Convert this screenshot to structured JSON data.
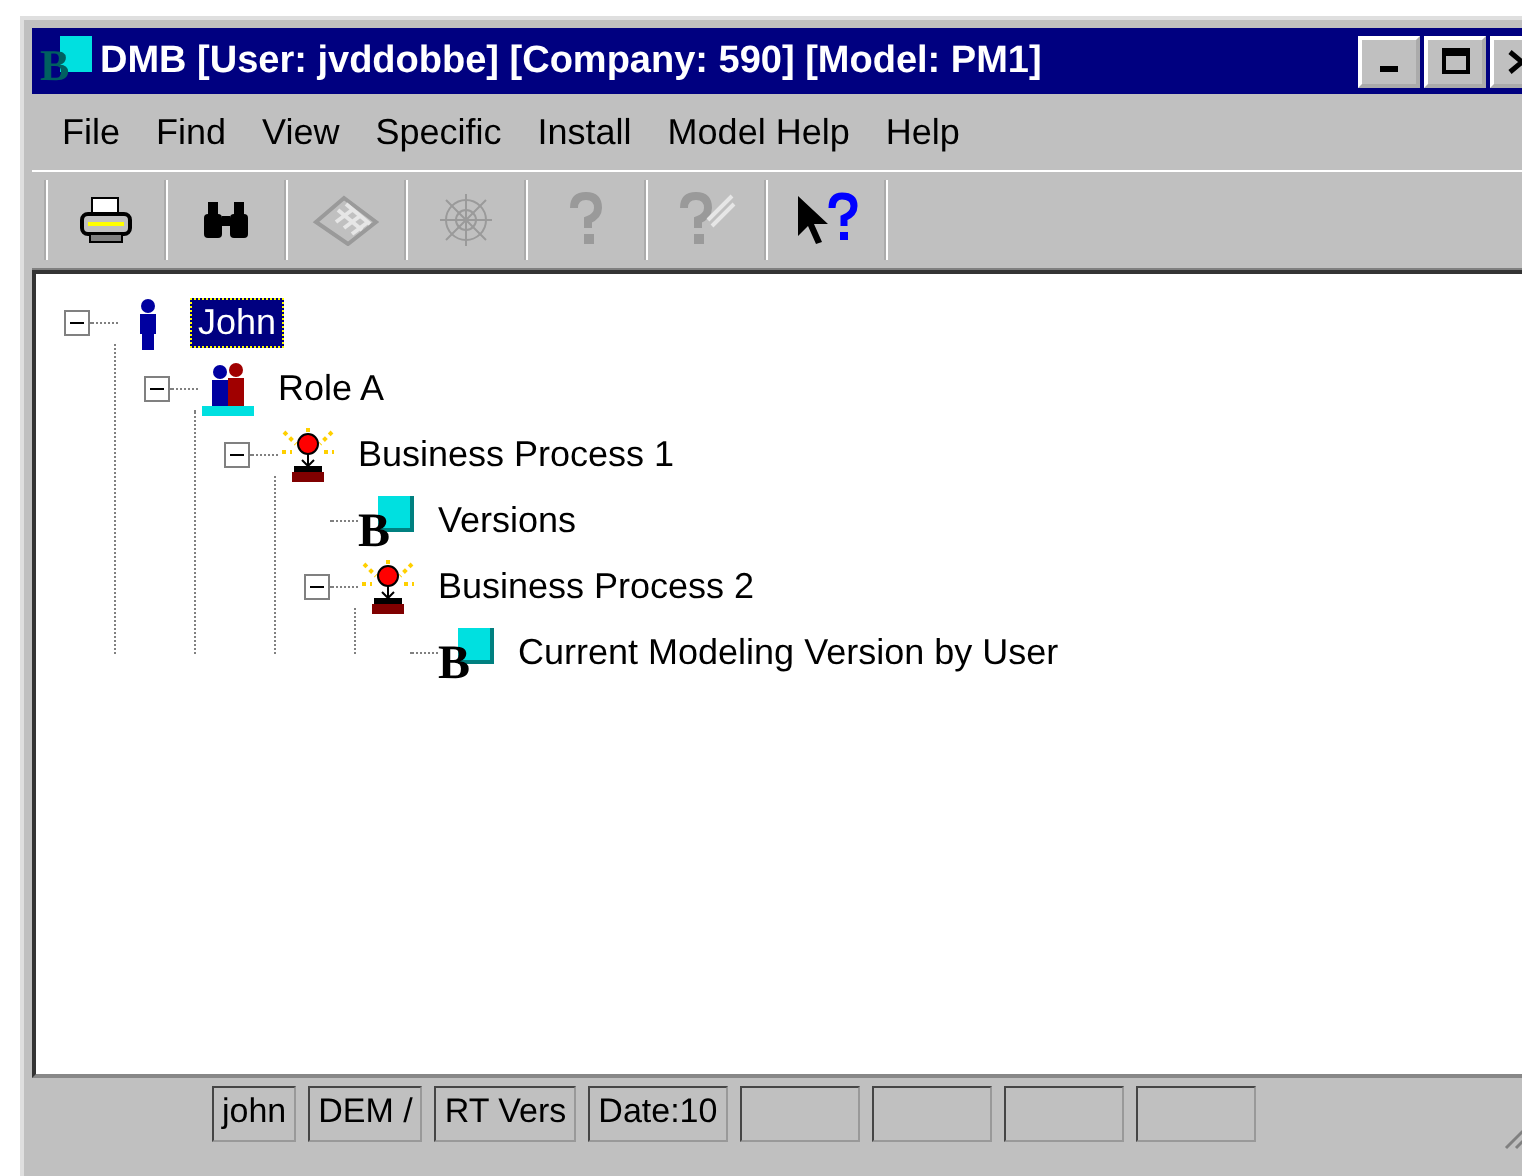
{
  "window": {
    "title": "DMB [User: jvddobbe] [Company: 590] [Model: PM1]",
    "app_badge": "B"
  },
  "menu": [
    {
      "label": "File"
    },
    {
      "label": "Find"
    },
    {
      "label": "View"
    },
    {
      "label": "Specific"
    },
    {
      "label": "Install"
    },
    {
      "label": "Model Help"
    },
    {
      "label": "Help"
    }
  ],
  "toolbar": [
    {
      "kind": "printer",
      "disabled": false
    },
    {
      "kind": "binoculars",
      "disabled": false
    },
    {
      "kind": "diamond",
      "disabled": true
    },
    {
      "kind": "web",
      "disabled": true
    },
    {
      "kind": "help",
      "disabled": true
    },
    {
      "kind": "help-check",
      "disabled": true
    },
    {
      "kind": "context-help",
      "disabled": false
    }
  ],
  "tree": [
    {
      "label": "John",
      "kind": "person",
      "selected": true,
      "expanded": true,
      "children": [
        {
          "label": "Role A",
          "kind": "role",
          "selected": false,
          "expanded": true,
          "children": [
            {
              "label": "Business Process 1",
              "kind": "process",
              "selected": false,
              "expanded": true,
              "children": [
                {
                  "label": "Versions",
                  "kind": "version",
                  "badge": "B",
                  "selected": false
                },
                {
                  "label": "Business Process 2",
                  "kind": "process",
                  "selected": false,
                  "expanded": true,
                  "children": [
                    {
                      "label": "Current Modeling Version by User",
                      "kind": "version",
                      "badge": "B",
                      "selected": false
                    }
                  ]
                }
              ]
            }
          ]
        }
      ]
    }
  ],
  "status_bar": [
    {
      "kind": "text",
      "text": "john"
    },
    {
      "kind": "text",
      "text": "DEM /"
    },
    {
      "kind": "text",
      "text": "RT Vers"
    },
    {
      "kind": "text",
      "text": "Date:10"
    },
    {
      "kind": "blank"
    },
    {
      "kind": "blank"
    },
    {
      "kind": "blank"
    },
    {
      "kind": "blank"
    }
  ]
}
